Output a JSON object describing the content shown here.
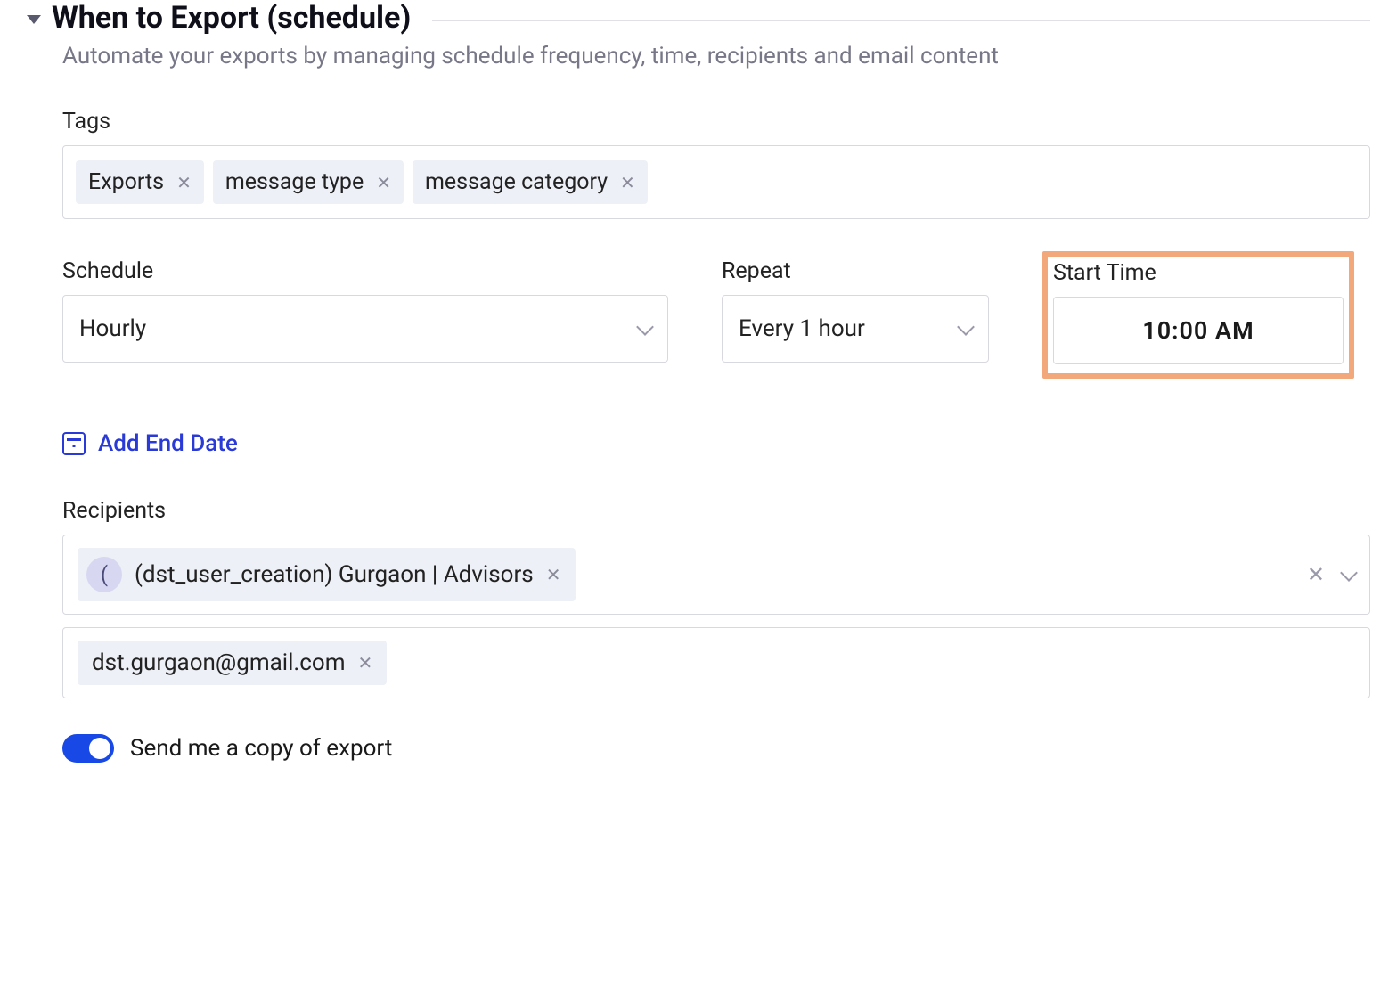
{
  "header": {
    "title": "When to Export (schedule)",
    "subtitle": "Automate your exports by managing schedule frequency, time, recipients and email content"
  },
  "tags": {
    "label": "Tags",
    "items": [
      "Exports",
      "message type",
      "message category"
    ]
  },
  "schedule": {
    "label": "Schedule",
    "value": "Hourly"
  },
  "repeat": {
    "label": "Repeat",
    "value": "Every 1 hour"
  },
  "start_time": {
    "label": "Start Time",
    "value": "10:00 AM"
  },
  "add_end_date": "Add End Date",
  "recipients": {
    "label": "Recipients",
    "group": {
      "avatar_initial": "(",
      "name": "(dst_user_creation) Gurgaon | Advisors"
    },
    "email": "dst.gurgaon@gmail.com"
  },
  "send_copy": {
    "label": "Send me a copy of export",
    "enabled": true
  }
}
